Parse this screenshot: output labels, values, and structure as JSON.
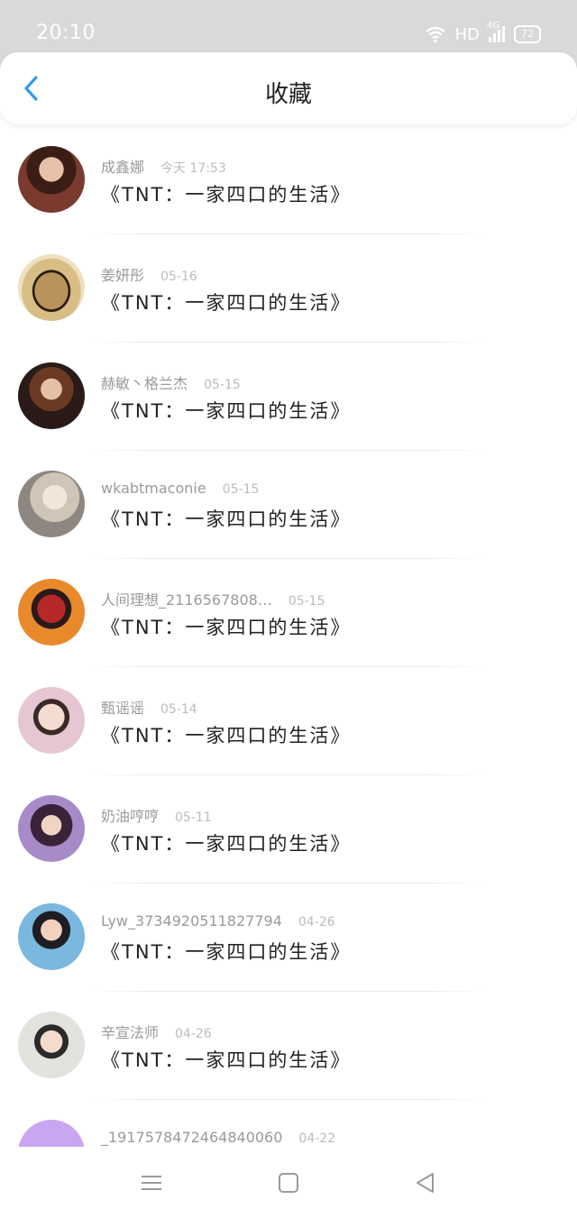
{
  "status_bar": {
    "time": "20:10",
    "network_label": "HD",
    "signal_label": "4G",
    "battery_level": "72"
  },
  "header": {
    "title": "收藏",
    "back_icon": "chevron-left-icon"
  },
  "items": [
    {
      "name": "成鑫娜",
      "date": "今天 17:53",
      "title": "《TNT：一家四口的生活》",
      "avatar_color": "#7a3b2e"
    },
    {
      "name": "姜妍彤",
      "date": "05-16",
      "title": "《TNT：一家四口的生活》",
      "avatar_color": "#c8a96b"
    },
    {
      "name": "赫敏丶格兰杰",
      "date": "05-15",
      "title": "《TNT：一家四口的生活》",
      "avatar_color": "#5a3a2e"
    },
    {
      "name": "wkabtmaconie",
      "date": "05-15",
      "title": "《TNT：一家四口的生活》",
      "avatar_color": "#b7a99c"
    },
    {
      "name": "人间理想_2116567808…",
      "date": "05-15",
      "title": "《TNT：一家四口的生活》",
      "avatar_color": "#e07a2a"
    },
    {
      "name": "甄谣谣",
      "date": "05-14",
      "title": "《TNT：一家四口的生活》",
      "avatar_color": "#d8b8c4"
    },
    {
      "name": "奶油哼哼",
      "date": "05-11",
      "title": "《TNT：一家四口的生活》",
      "avatar_color": "#8e6fb3"
    },
    {
      "name": "Lyw_3734920511827794",
      "date": "04-26",
      "title": "《TNT：一家四口的生活》",
      "avatar_color": "#5ea0c8"
    },
    {
      "name": "辛宣法师",
      "date": "04-26",
      "title": "《TNT：一家四口的生活》",
      "avatar_color": "#c9c4b6"
    },
    {
      "name": "_1917578472464840060",
      "date": "04-22",
      "title": "",
      "avatar_color": "#c9a6f0"
    }
  ],
  "nav": {
    "menu_icon": "menu-icon",
    "home_icon": "square-home-icon",
    "back_icon": "triangle-back-icon"
  },
  "colors": {
    "accent": "#2f9bf0",
    "status_bar": "#d9d9d9"
  }
}
